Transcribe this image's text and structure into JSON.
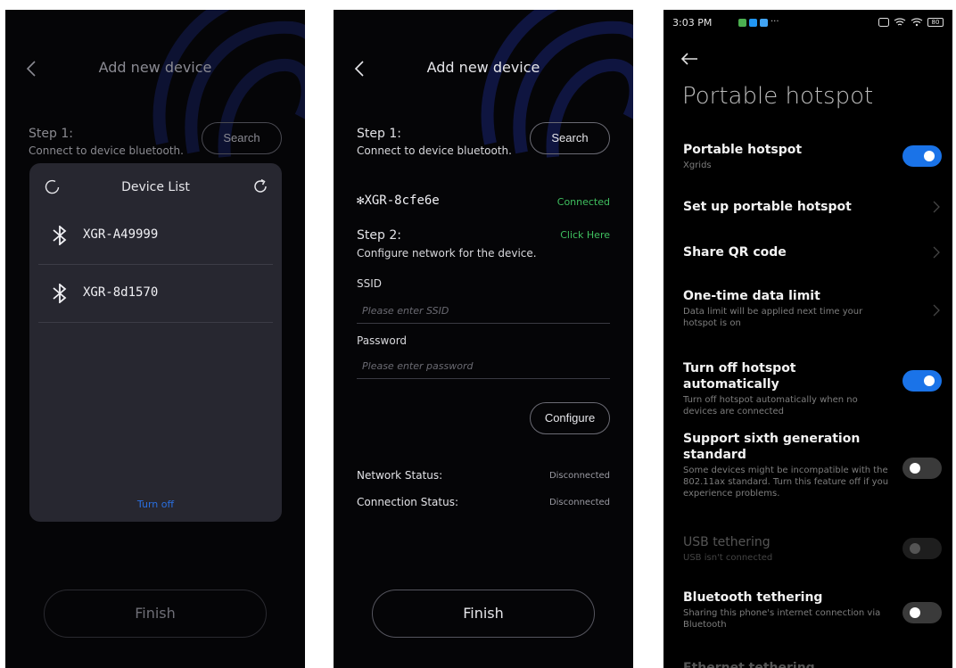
{
  "screen1": {
    "title": "Add new device",
    "step1_title": "Step 1:",
    "step1_desc": "Connect to device bluetooth.",
    "search_label": "Search",
    "device_list": {
      "title": "Device List",
      "devices": [
        "XGR-A49999",
        "XGR-8d1570"
      ],
      "turn_off_label": "Turn off"
    },
    "finish_label": "Finish"
  },
  "screen2": {
    "title": "Add new device",
    "step1_title": "Step 1:",
    "step1_desc": "Connect to device bluetooth.",
    "search_label": "Search",
    "device_name": "XGR-8cfe6e",
    "device_status": "Connected",
    "step2_title": "Step 2:",
    "step2_desc": "Configure network for the device.",
    "click_here": "Click Here",
    "ssid_label": "SSID",
    "ssid_placeholder": "Please enter SSID",
    "password_label": "Password",
    "password_placeholder": "Please enter password",
    "configure_label": "Configure",
    "network_status_label": "Network Status:",
    "network_status_value": "Disconnected",
    "connection_status_label": "Connection Status:",
    "connection_status_value": "Disconnected",
    "finish_label": "Finish"
  },
  "screen3": {
    "time": "3:03 PM",
    "battery": "80",
    "title": "Portable hotspot",
    "items": [
      {
        "title": "Portable hotspot",
        "subtitle": "Xgrids",
        "control": "toggle",
        "state": "on"
      },
      {
        "title": "Set up portable hotspot",
        "subtitle": "",
        "control": "chevron"
      },
      {
        "title": "Share QR code",
        "subtitle": "",
        "control": "chevron"
      },
      {
        "title": "One-time data limit",
        "subtitle": "Data limit will be applied next time your hotspot is on",
        "control": "chevron"
      },
      {
        "title": "Turn off hotspot automatically",
        "subtitle": "Turn off hotspot automatically when no devices are connected",
        "control": "toggle",
        "state": "on"
      },
      {
        "title": "Support sixth generation standard",
        "subtitle": "Some devices might be incompatible with the 802.11ax standard. Turn this feature off if you experience problems.",
        "control": "toggle",
        "state": "off"
      },
      {
        "title": "USB tethering",
        "subtitle": "USB isn't connected",
        "control": "toggle",
        "state": "disabled"
      },
      {
        "title": "Bluetooth tethering",
        "subtitle": "Sharing this phone's internet connection via Bluetooth",
        "control": "toggle",
        "state": "off"
      },
      {
        "title": "Ethernet tethering",
        "subtitle": "",
        "control": "none"
      }
    ]
  },
  "colors": {
    "background": "#050507",
    "panel": "#272730",
    "accent_blue": "#1a73e8",
    "connected_green": "#3fbf5f",
    "turn_off_blue": "#2a6fe0"
  }
}
